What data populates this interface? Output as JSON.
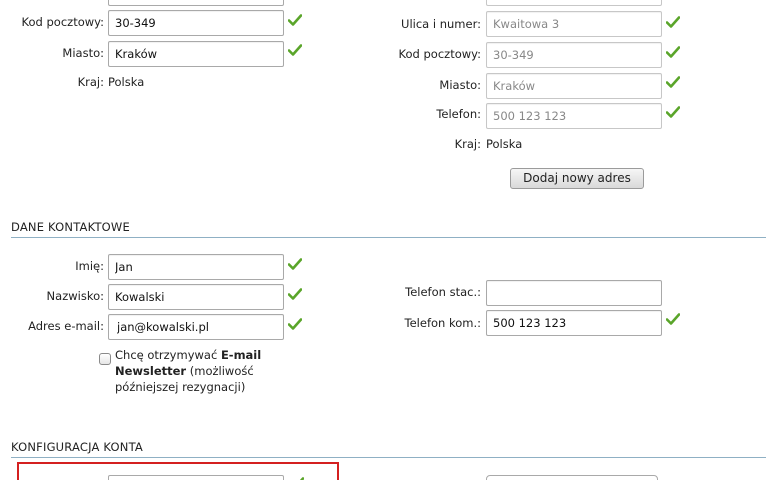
{
  "left_address": {
    "postal_code_label": "Kod pocztowy:",
    "postal_code_value": "30-349",
    "city_label": "Miasto:",
    "city_value": "Kraków",
    "country_label": "Kraj:",
    "country_value": "Polska"
  },
  "right_address": {
    "street_label": "Ulica i numer:",
    "street_value": "Kwaitowa 3",
    "postal_code_label": "Kod pocztowy:",
    "postal_code_value": "30-349",
    "city_label": "Miasto:",
    "city_value": "Kraków",
    "phone_label": "Telefon:",
    "phone_value": "500 123 123",
    "country_label": "Kraj:",
    "country_value": "Polska",
    "add_button": "Dodaj nowy adres"
  },
  "contact": {
    "section_title": "DANE KONTAKTOWE",
    "first_name_label": "Imię:",
    "first_name_value": "Jan",
    "last_name_label": "Nazwisko:",
    "last_name_value": "Kowalski",
    "email_label": "Adres e-mail:",
    "email_value": "jan@kowalski.pl",
    "landline_label": "Telefon stac.:",
    "landline_value": "",
    "mobile_label": "Telefon kom.:",
    "mobile_value": "500 123 123",
    "newsletter_pre": "Chcę otrzymywać ",
    "newsletter_bold": "E-mail Newsletter",
    "newsletter_post": " (możliwość późniejszej rezygnacji)"
  },
  "account": {
    "section_title": "KONFIGURACJA KONTA"
  },
  "colors": {
    "check_green": "#5aa52a",
    "section_line": "#8fb0c4",
    "highlight_red": "#d42020"
  },
  "icons": {
    "valid": "check-icon"
  }
}
